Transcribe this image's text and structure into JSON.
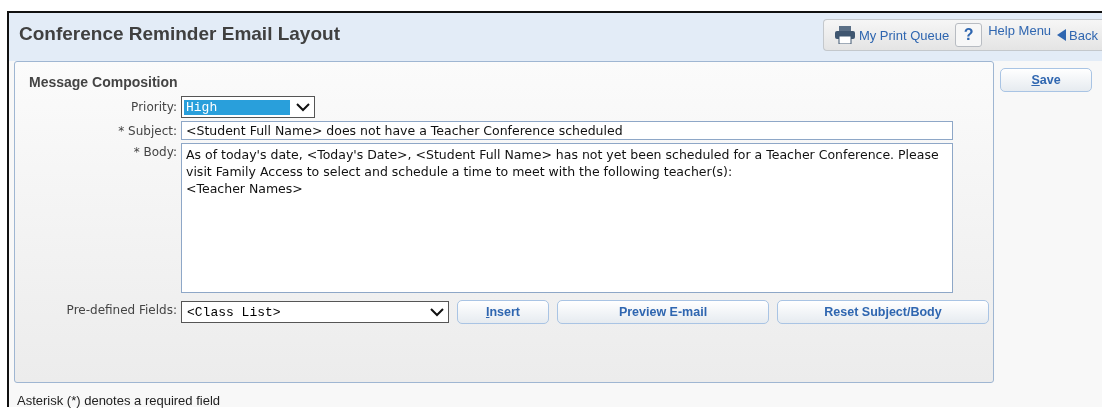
{
  "header": {
    "title": "Conference Reminder Email Layout",
    "toolbar": {
      "print_queue": "My Print Queue",
      "help_icon": "?",
      "help_menu": "Help Menu",
      "back": "Back"
    }
  },
  "panel": {
    "title": "Message Composition",
    "priority": {
      "label": "Priority:",
      "value": "High"
    },
    "subject": {
      "label": "* Subject:",
      "value": "<Student Full Name> does not have a Teacher Conference scheduled"
    },
    "body": {
      "label": "* Body:",
      "value": "As of today's date, <Today's Date>, <Student Full Name> has not yet been scheduled for a Teacher Conference. Please visit Family Access to select and schedule a time to meet with the following teacher(s):\n<Teacher Names>"
    },
    "predefined": {
      "label": "Pre-defined Fields:",
      "value": "<Class List>"
    },
    "buttons": [
      {
        "label": "Insert",
        "kind": "small"
      },
      {
        "label": "Preview E-mail",
        "kind": "wide"
      },
      {
        "label": "Reset Subject/Body",
        "kind": "wide"
      }
    ]
  },
  "save_button": "Save",
  "footnote": "Asterisk (*) denotes a required field"
}
